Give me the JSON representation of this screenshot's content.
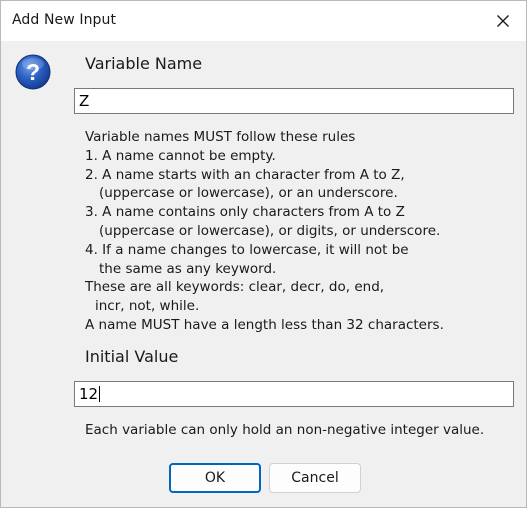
{
  "window": {
    "title": "Add New Input",
    "close_icon": "close-icon",
    "help_icon": "question-icon"
  },
  "variable_name": {
    "heading": "Variable Name",
    "value": "Z"
  },
  "rules": {
    "lines": [
      "Variable names MUST follow these rules",
      "1. A name cannot be empty.",
      "2. A name starts with an character from A to Z,",
      "(uppercase or lowercase), or an underscore.",
      "3. A name contains only characters from A to Z",
      "(uppercase or lowercase), or digits, or underscore.",
      "4. If a name changes to lowercase, it will not be",
      "the same as any keyword.",
      "These are all keywords: clear, decr, do, end,",
      "incr, not, while.",
      "A name MUST have a length less than 32 characters."
    ]
  },
  "initial_value": {
    "heading": "Initial Value",
    "value": "12"
  },
  "note": "Each variable can only hold an non-negative integer value.",
  "buttons": {
    "ok_label": "OK",
    "cancel_label": "Cancel"
  },
  "colors": {
    "accent": "#0067c0",
    "dialog_background": "#f0f0f0",
    "titlebar": "#ffffff"
  }
}
